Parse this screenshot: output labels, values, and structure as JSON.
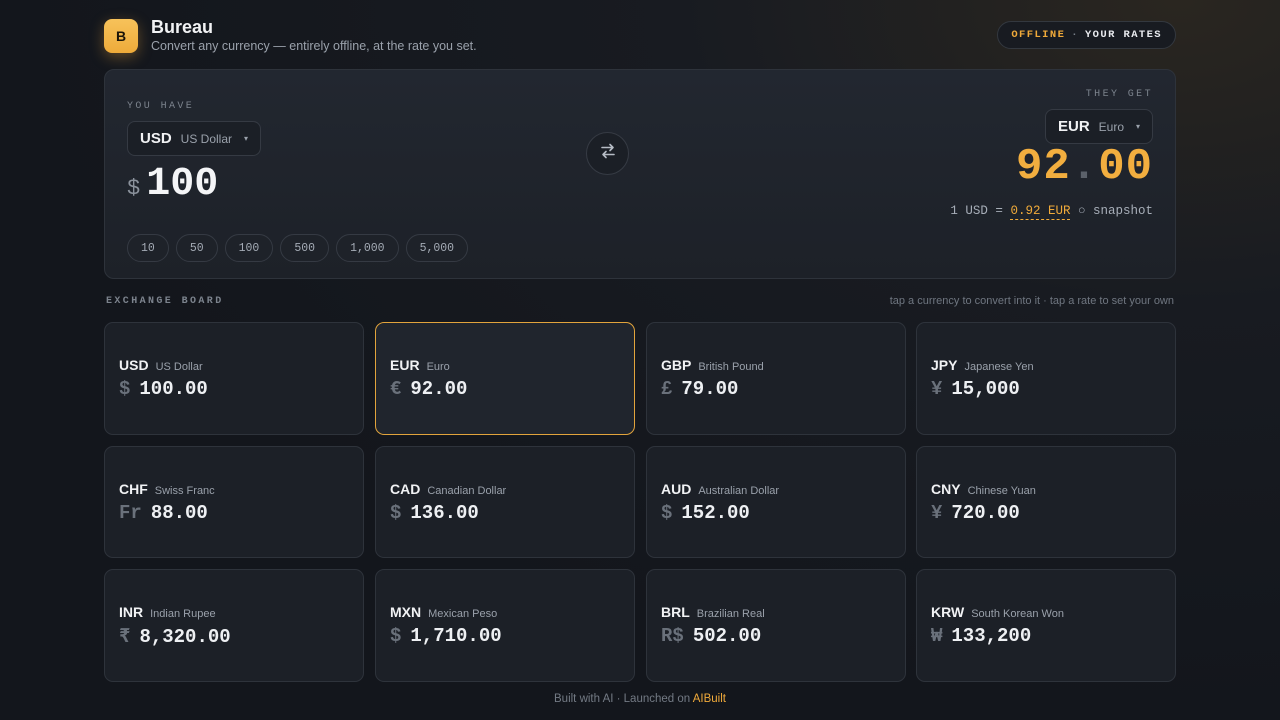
{
  "header": {
    "logo_letter": "B",
    "title": "Bureau",
    "subtitle": "Convert any currency — entirely offline, at the rate you set.",
    "badge_offline": "OFFLINE",
    "badge_sep": "·",
    "badge_rates": "YOUR RATES"
  },
  "converter": {
    "you_have_label": "YOU HAVE",
    "they_get_label": "THEY GET",
    "from": {
      "code": "USD",
      "name": "US Dollar",
      "caret": "▾"
    },
    "to": {
      "code": "EUR",
      "name": "Euro",
      "caret": "▾"
    },
    "amount_symbol": "$",
    "amount": "100",
    "presets": [
      "10",
      "50",
      "100",
      "500",
      "1,000",
      "5,000"
    ],
    "result_int": "92",
    "result_dot": ".",
    "result_dec": "00",
    "rate_prefix": "1 USD =",
    "rate_value": "0.92 EUR",
    "rate_suffix": "○ snapshot"
  },
  "board": {
    "title": "EXCHANGE BOARD",
    "hint": "tap a currency to convert into it · tap a rate to set your own",
    "cards": [
      {
        "code": "USD",
        "name": "US Dollar",
        "symbol": "$",
        "value": "100.00",
        "active": false
      },
      {
        "code": "EUR",
        "name": "Euro",
        "symbol": "€",
        "value": "92.00",
        "active": true
      },
      {
        "code": "GBP",
        "name": "British Pound",
        "symbol": "£",
        "value": "79.00",
        "active": false
      },
      {
        "code": "JPY",
        "name": "Japanese Yen",
        "symbol": "¥",
        "value": "15,000",
        "active": false
      },
      {
        "code": "CHF",
        "name": "Swiss Franc",
        "symbol": "Fr",
        "value": "88.00",
        "active": false
      },
      {
        "code": "CAD",
        "name": "Canadian Dollar",
        "symbol": "$",
        "value": "136.00",
        "active": false
      },
      {
        "code": "AUD",
        "name": "Australian Dollar",
        "symbol": "$",
        "value": "152.00",
        "active": false
      },
      {
        "code": "CNY",
        "name": "Chinese Yuan",
        "symbol": "¥",
        "value": "720.00",
        "active": false
      },
      {
        "code": "INR",
        "name": "Indian Rupee",
        "symbol": "₹",
        "value": "8,320.00",
        "active": false
      },
      {
        "code": "MXN",
        "name": "Mexican Peso",
        "symbol": "$",
        "value": "1,710.00",
        "active": false
      },
      {
        "code": "BRL",
        "name": "Brazilian Real",
        "symbol": "R$",
        "value": "502.00",
        "active": false
      },
      {
        "code": "KRW",
        "name": "South Korean Won",
        "symbol": "₩",
        "value": "133,200",
        "active": false
      }
    ]
  },
  "footer": {
    "text": "Built with AI · Launched on",
    "link": "AIBuilt"
  },
  "colors": {
    "accent": "#f0aa3a",
    "background": "#14171d",
    "card_border_active": "#e2a43c"
  },
  "icons": {
    "swap": "swap-arrows-icon",
    "caret": "chevron-down-icon"
  }
}
